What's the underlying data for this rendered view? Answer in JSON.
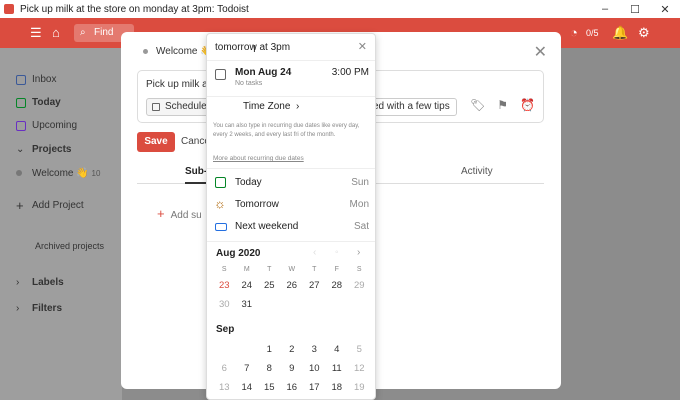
{
  "window": {
    "title": "Pick up milk at the store on monday at 3pm: Todoist",
    "controls": [
      "–",
      "☐",
      "✕"
    ]
  },
  "topbar": {
    "search_placeholder": "Find",
    "karma": "0/5",
    "accent_color": "#db4c3f"
  },
  "sidebar": {
    "items": [
      {
        "label": "Inbox",
        "icon": "inbox-icon"
      },
      {
        "label": "Today",
        "icon": "today-icon"
      },
      {
        "label": "Upcoming",
        "icon": "upcoming-icon"
      },
      {
        "label": "Projects",
        "icon": "chevron-down-icon"
      },
      {
        "label": "Welcome 👋",
        "count": "10",
        "icon": "project-dot-icon"
      },
      {
        "label": "Add Project",
        "icon": "plus-icon"
      },
      {
        "label": "Archived projects",
        "icon": ""
      },
      {
        "label": "Labels",
        "icon": "chevron-right-icon"
      },
      {
        "label": "Filters",
        "icon": "chevron-right-icon"
      }
    ]
  },
  "modal": {
    "breadcrumb": "Welcome 👋",
    "task_text": "Pick up milk at",
    "schedule_label": "Schedule",
    "tips_label": "ed with a few tips",
    "save_label": "Save",
    "cancel_label": "Cance",
    "tabs": [
      "Sub-t",
      "Activity"
    ],
    "add_subtask": "Add su"
  },
  "date_picker": {
    "input_value": "tomorrow at 3pm",
    "preview": {
      "date": "Mon Aug 24",
      "subtitle": "No tasks",
      "time": "3:00 PM"
    },
    "time_zone": "Time Zone",
    "help_text": "You can also type in recurring due dates like every day, every 2 weeks, and every last fri of the month.",
    "help_link": "More about recurring due dates",
    "quick_options": [
      {
        "label": "Today",
        "day": "Sun",
        "icon": "today-icon"
      },
      {
        "label": "Tomorrow",
        "day": "Mon",
        "icon": "sun-icon"
      },
      {
        "label": "Next weekend",
        "day": "Sat",
        "icon": "couch-icon"
      }
    ],
    "calendar": {
      "month1": "Aug 2020",
      "weekdays": [
        "S",
        "M",
        "T",
        "W",
        "T",
        "F",
        "S"
      ],
      "aug_weeks": [
        [
          "23",
          "24",
          "25",
          "26",
          "27",
          "28",
          "29"
        ],
        [
          "30",
          "31",
          "",
          "",
          "",
          "",
          ""
        ]
      ],
      "month2": "Sep",
      "sep_weeks": [
        [
          "",
          "",
          "1",
          "2",
          "3",
          "4",
          "5"
        ],
        [
          "6",
          "7",
          "8",
          "9",
          "10",
          "11",
          "12"
        ],
        [
          "13",
          "14",
          "15",
          "16",
          "17",
          "18",
          "19"
        ]
      ]
    }
  }
}
